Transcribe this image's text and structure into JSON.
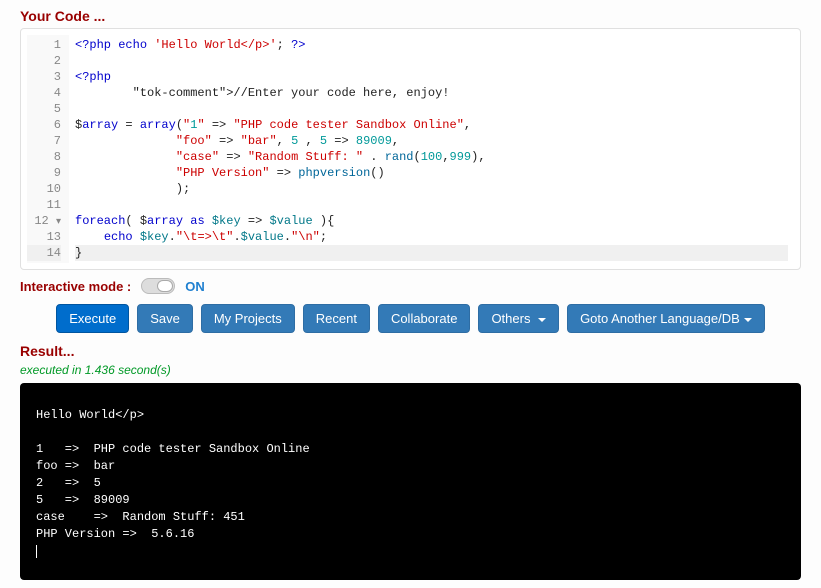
{
  "sections": {
    "code_title": "Your Code ...",
    "result_title": "Result...",
    "result_meta": "executed in 1.436 second(s)"
  },
  "interactive": {
    "label": "Interactive mode :",
    "state": "ON"
  },
  "buttons": {
    "execute": "Execute",
    "save": "Save",
    "projects": "My Projects",
    "recent": "Recent",
    "collaborate": "Collaborate",
    "others": "Others ",
    "goto": "Goto Another Language/DB"
  },
  "gutter": [
    "1",
    "2",
    "3",
    "4",
    "5",
    "6",
    "7",
    "8",
    "9",
    "10",
    "11",
    "12",
    "13",
    "14"
  ],
  "code_raw": [
    "<?php echo 'Hello World</p>'; ?>",
    "",
    "<?php",
    "        //Enter your code here, enjoy!",
    "",
    "$array = array(\"1\" => \"PHP code tester Sandbox Online\",  ",
    "              \"foo\" => \"bar\", 5 , 5 => 89009, ",
    "              \"case\" => \"Random Stuff: \" . rand(100,999),",
    "              \"PHP Version\" => phpversion()",
    "              );",
    "            ",
    "foreach( $array as $key => $value ){",
    "    echo $key.\"\\t=>\\t\".$value.\"\\n\";",
    "}"
  ],
  "fold_line": 12,
  "active_line": 14,
  "console_output": "Hello World</p>\n\n1   =>  PHP code tester Sandbox Online\nfoo =>  bar\n2   =>  5\n5   =>  89009\ncase    =>  Random Stuff: 451\nPHP Version =>  5.6.16"
}
